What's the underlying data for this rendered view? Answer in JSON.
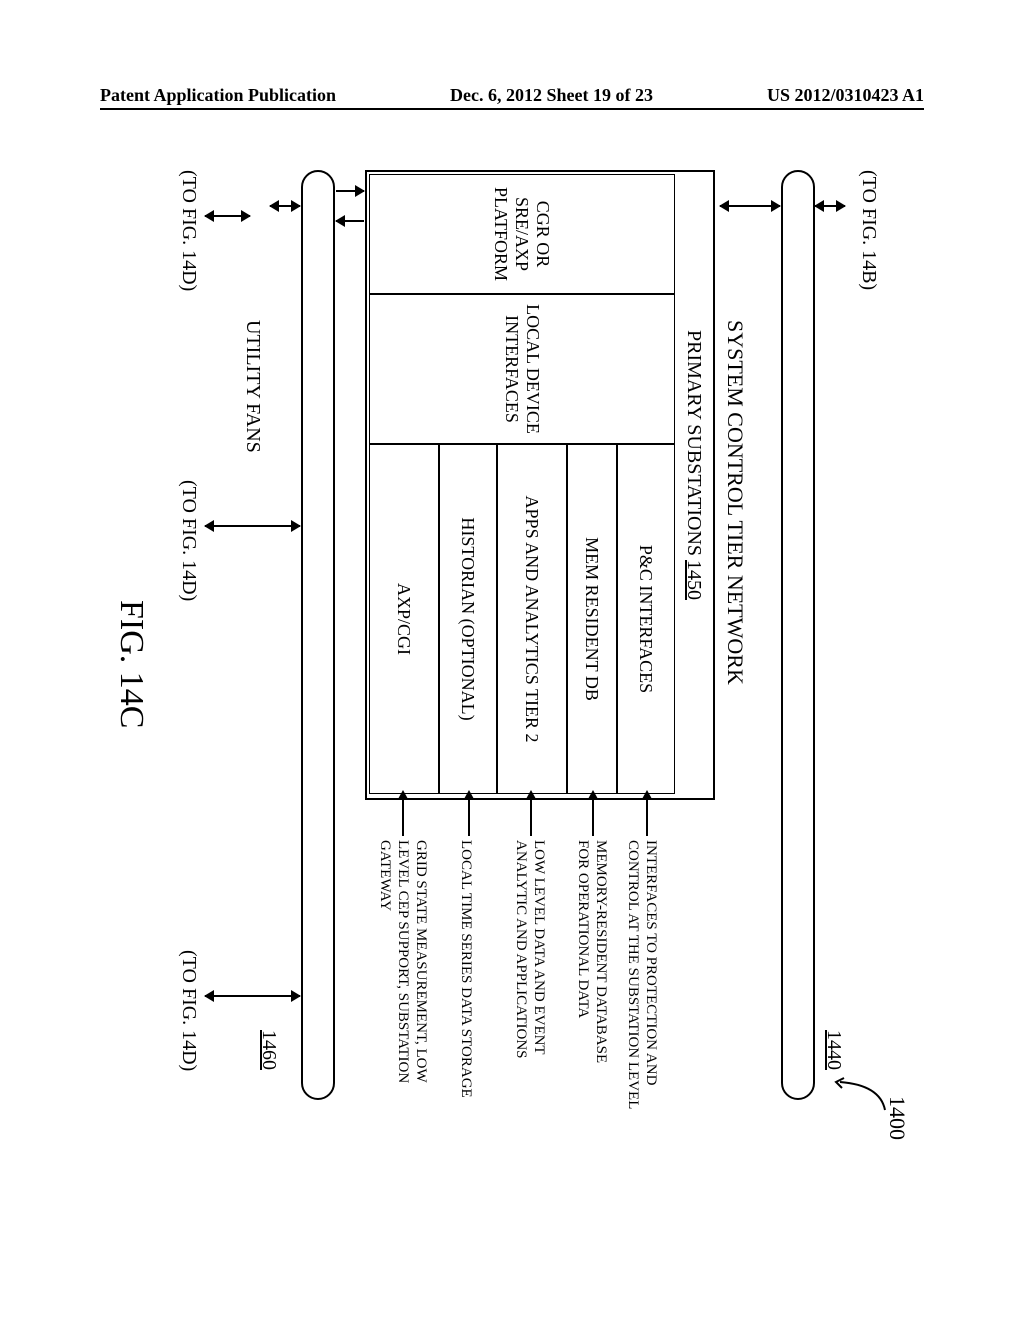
{
  "header": {
    "left": "Patent Application Publication",
    "center": "Dec. 6, 2012  Sheet 19 of 23",
    "right": "US 2012/0310423 A1"
  },
  "refs": {
    "overall": "1400",
    "bus_top": "1440",
    "primary": "1450",
    "bus_bottom": "1460"
  },
  "links": {
    "top": "(TO FIG. 14B)",
    "bottom": "(TO FIG. 14D)"
  },
  "titles": {
    "system": "SYSTEM CONTROL TIER NETWORK",
    "primary": "PRIMARY SUBSTATIONS",
    "utility": "UTILITY FANS"
  },
  "boxes": {
    "col_left": "CGR OR SRE/AXP PLATFORM",
    "col_mid": "LOCAL DEVICE INTERFACES",
    "row1": "P&C INTERFACES",
    "row2": "MEM RESIDENT DB",
    "row3": "APPS AND ANALYTICS TIER 2",
    "row4": "HISTORIAN (OPTIONAL)",
    "row5": "AXP/CGI"
  },
  "descriptions": {
    "d1": "INTERFACES TO PROTECTION AND CONTROL AT THE SUBSTATION LEVEL",
    "d2": "MEMORY-RESIDENT DATABASE FOR OPERATIONAL DATA",
    "d3": "LOW LEVEL DATA AND EVENT ANALYTIC AND APPLICATIONS",
    "d4": "LOCAL TIME SERIES DATA STORAGE",
    "d5": "GRID STATE MEASUREMENT, LOW LEVEL CEP SUPPORT, SUBSTATION GATEWAY"
  },
  "figure_label": "FIG. 14C"
}
